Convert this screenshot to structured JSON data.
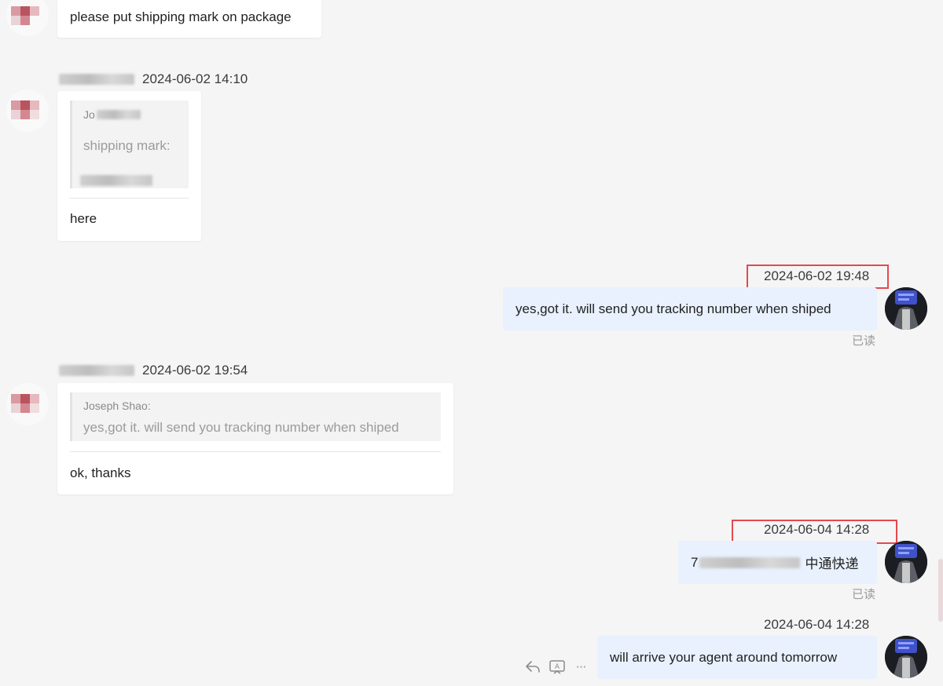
{
  "messages": [
    {
      "text": "please put shipping mark on package"
    },
    {
      "timestamp": "2024-06-02 14:10",
      "quote": {
        "sender": "Jo",
        "text": "shipping mark:"
      },
      "text": "here"
    },
    {
      "timestamp": "2024-06-02 19:48",
      "text": "yes,got it. will send you  tracking number when shiped",
      "status": "已读"
    },
    {
      "timestamp": "2024-06-02 19:54",
      "quote": {
        "sender": "Joseph Shao:",
        "text": "yes,got it. will send you  tracking number when shiped"
      },
      "text": "ok, thanks"
    },
    {
      "timestamp": "2024-06-04 14:28",
      "text_prefix": "7",
      "text_suffix": "中通快递",
      "status": "已读"
    },
    {
      "timestamp": "2024-06-04 14:28",
      "text": "will arrive your agent around  tomorrow"
    }
  ],
  "actions": {
    "reply_icon": "reply-icon",
    "translate_icon": "translate-icon",
    "more_glyph": "···"
  },
  "colors": {
    "page_bg": "#f5f5f5",
    "incoming_bubble": "#ffffff",
    "outgoing_bubble": "#e8f1fd",
    "highlight": "#e5484d"
  }
}
